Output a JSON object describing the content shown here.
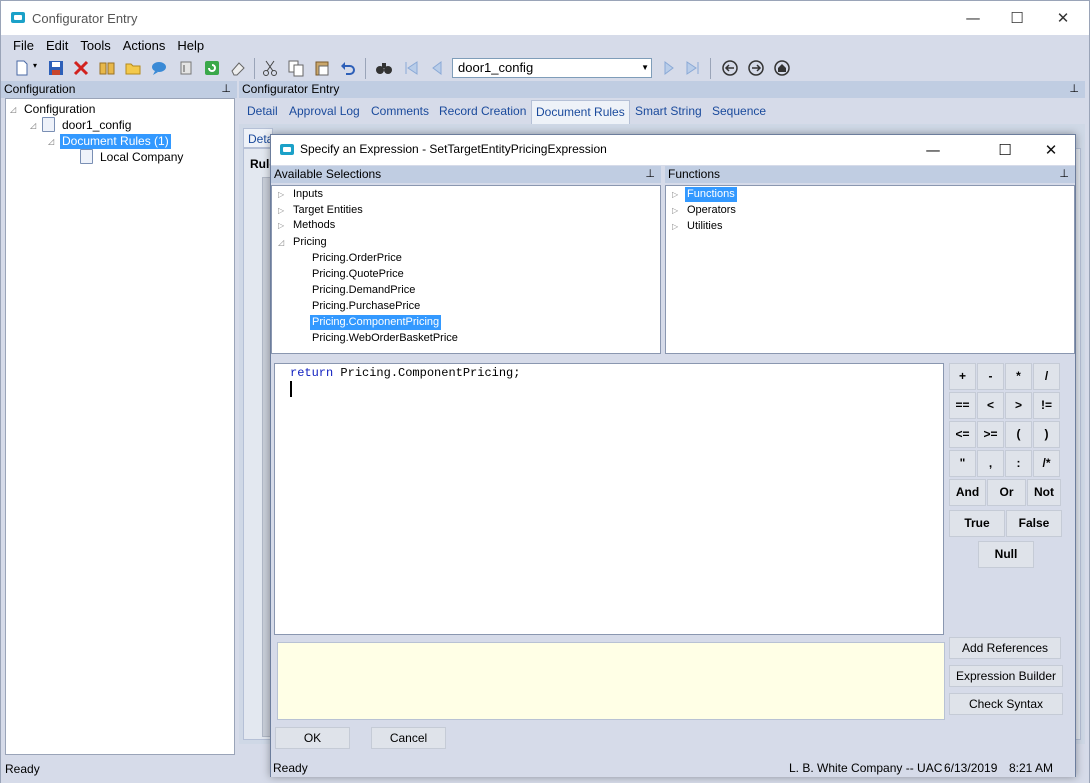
{
  "window": {
    "title": "Configurator Entry",
    "controls": {
      "minimize": "—",
      "maximize": "☐",
      "close": "✕"
    }
  },
  "menu": [
    "File",
    "Edit",
    "Tools",
    "Actions",
    "Help"
  ],
  "toolbar": {
    "combo_value": "door1_config"
  },
  "left_panel": {
    "header": "Configuration",
    "pin": "📌",
    "tree": {
      "root": "Configuration",
      "child": "door1_config",
      "grandchild": "Document Rules (1)",
      "leaf": "Local Company"
    }
  },
  "right_panel": {
    "header": "Configurator Entry",
    "tabs": [
      "Detail",
      "Approval Log",
      "Comments",
      "Record Creation",
      "Document Rules",
      "Smart String",
      "Sequence"
    ],
    "active_tab": "Document Rules",
    "subtab_fragment": "Detai",
    "rule_fragment": "Rule"
  },
  "dialog": {
    "title": "Specify an Expression - SetTargetEntityPricingExpression",
    "available_header": "Available Selections",
    "functions_header": "Functions",
    "available": {
      "groups": [
        "Inputs",
        "Target Entities",
        "Methods",
        "Pricing"
      ],
      "pricing_items": [
        "Pricing.OrderPrice",
        "Pricing.QuotePrice",
        "Pricing.DemandPrice",
        "Pricing.PurchasePrice",
        "Pricing.ComponentPricing",
        "Pricing.WebOrderBasketPrice"
      ],
      "selected": "Pricing.ComponentPricing"
    },
    "functions": {
      "items": [
        "Functions",
        "Operators",
        "Utilities"
      ],
      "selected": "Functions"
    },
    "expression": {
      "keyword": "return",
      "text": " Pricing.ComponentPricing;"
    },
    "keypad": {
      "row1": [
        "+",
        "-",
        "*",
        "/"
      ],
      "row2": [
        "==",
        "<",
        ">",
        "!="
      ],
      "row3": [
        "<=",
        ">=",
        "(",
        ")"
      ],
      "row4": [
        "\"",
        ",",
        ":",
        "/*"
      ],
      "logic": [
        "And",
        "Or",
        "Not"
      ],
      "bool": [
        "True",
        "False"
      ],
      "null": "Null"
    },
    "side_buttons": [
      "Add References",
      "Expression Builder",
      "Check Syntax"
    ],
    "ok": "OK",
    "cancel": "Cancel",
    "status": "Ready"
  },
  "statusbar": {
    "left": "Ready",
    "company": "L. B. White Company -- UAC",
    "date": "6/13/2019",
    "time": "8:21 AM"
  }
}
